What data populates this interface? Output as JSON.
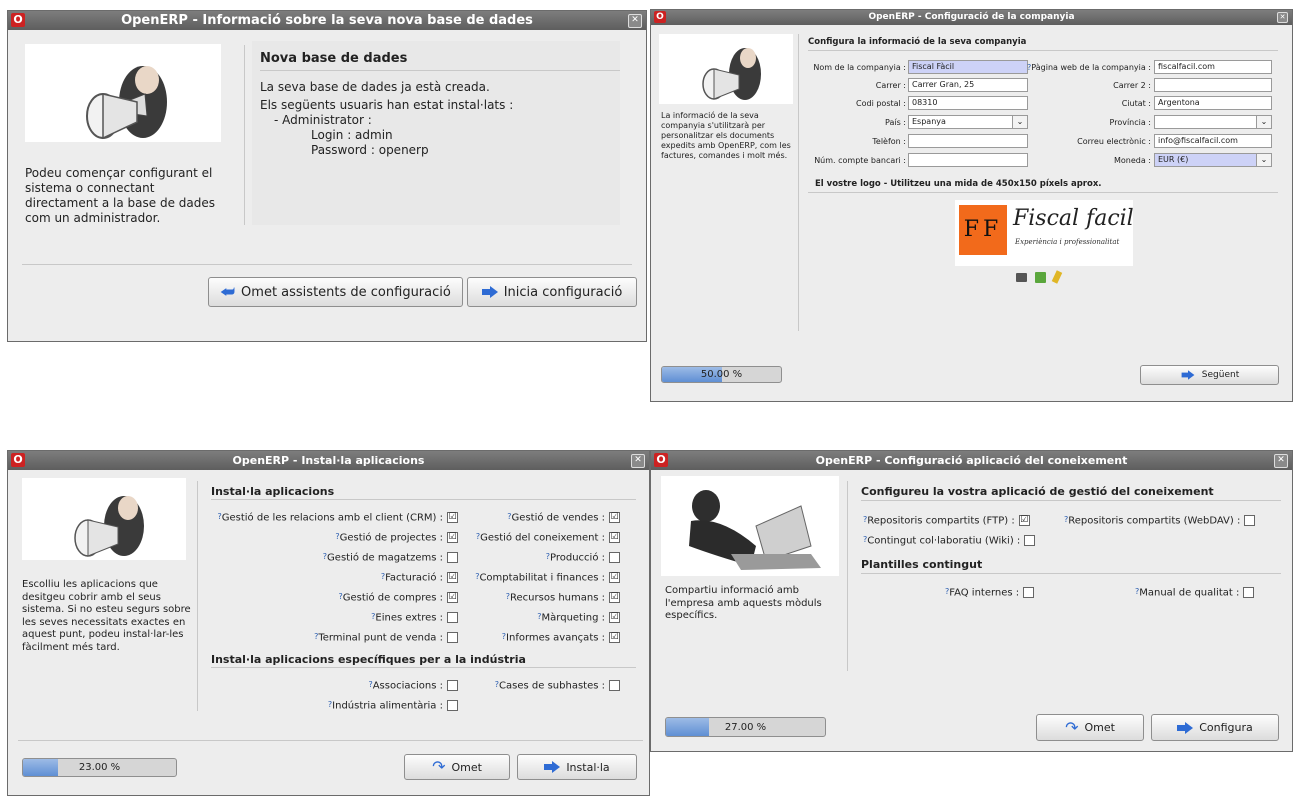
{
  "w1": {
    "title": "OpenERP - Informació sobre la seva nova base de dades",
    "section": "Nova base de dades",
    "line1": "La seva base de dades ja està creada.",
    "line2": "Els següents usuaris han estat instal·lats :",
    "line3": "- Administrator :",
    "line4": "Login : admin",
    "line5": "Password : openerp",
    "desc": "Podeu començar configurant el sistema o connectant directament a la base de dades com un administrador.",
    "skip_button": "Omet assistents de configuració",
    "start_button": "Inicia configuració"
  },
  "w2": {
    "title": "OpenERP - Configuració de la companyia",
    "section": "Configura la informació de la seva companyia",
    "desc": "La informació de la seva companyia s'utilitzarà per personalitzar els documents expedits amb OpenERP, com les factures, comandes i molt més.",
    "labels": {
      "name": "Nom de la companyia :",
      "street": "Carrer :",
      "zip": "Codi postal :",
      "country": "País :",
      "phone": "Telèfon :",
      "bank": "Núm. compte bancari :",
      "web": "Pàgina web de la companyia :",
      "street2": "Carrer 2 :",
      "city": "Ciutat :",
      "province": "Província :",
      "email": "Correu electrònic :",
      "currency": "Moneda :"
    },
    "values": {
      "name": "Fiscal Fàcil",
      "street": "Carrer Gran, 25",
      "zip": "08310",
      "country": "Espanya",
      "phone": "",
      "bank": "",
      "web": "fiscalfacil.com",
      "street2": "",
      "city": "Argentona",
      "province": "",
      "email": "info@fiscalfacil.com",
      "currency": "EUR (€)"
    },
    "logo_section": "El vostre logo - Utilitzeu una mida de 450x150 píxels aprox.",
    "logo_mark": "FF",
    "logo_name": "Fiscal facil",
    "logo_tagline": "Experiència i professionalitat",
    "progress_text": "50.00 %",
    "progress_value": 0.5,
    "next_button": "Següent"
  },
  "w3": {
    "title": "OpenERP - Instal·la aplicacions",
    "section1": "Instal·la aplicacions",
    "section2": "Instal·la aplicacions específiques per a la indústria",
    "desc": "Escolliu les aplicacions que desitgeu cobrir amb el seus sistema. Si no esteu segurs sobre les seves necessitats exactes en aquest punt, podeu instal·lar-les fàcilment més tard.",
    "apps_left": [
      {
        "label": "Gestió de les relacions amb el client (CRM) :",
        "checked": "☑"
      },
      {
        "label": "Gestió de projectes :",
        "checked": "☑"
      },
      {
        "label": "Gestió de magatzems :",
        "checked": ""
      },
      {
        "label": "Facturació :",
        "checked": "☑"
      },
      {
        "label": "Gestió de compres :",
        "checked": "☑"
      },
      {
        "label": "Eines extres :",
        "checked": ""
      },
      {
        "label": "Terminal punt de venda :",
        "checked": ""
      }
    ],
    "apps_right": [
      {
        "label": "Gestió de vendes :",
        "checked": "☑"
      },
      {
        "label": "Gestió del coneixement :",
        "checked": "☑"
      },
      {
        "label": "Producció :",
        "checked": ""
      },
      {
        "label": "Comptabilitat i finances :",
        "checked": "☑"
      },
      {
        "label": "Recursos humans :",
        "checked": "☑"
      },
      {
        "label": "Màrqueting :",
        "checked": "☑"
      },
      {
        "label": "Informes avançats :",
        "checked": "☑"
      }
    ],
    "ind_left": [
      {
        "label": "Associacions :",
        "checked": ""
      },
      {
        "label": "Indústria alimentària :",
        "checked": ""
      }
    ],
    "ind_right": [
      {
        "label": "Cases de subhastes :",
        "checked": ""
      }
    ],
    "progress_text": "23.00 %",
    "progress_value": 0.23,
    "skip_button": "Omet",
    "install_button": "Instal·la"
  },
  "w4": {
    "title": "OpenERP - Configuració aplicació del coneixement",
    "section1": "Configureu la vostra aplicació de gestió del coneixement",
    "section2": "Plantilles contingut",
    "desc": "Compartiu informació amb l'empresa amb aquests mòduls específics.",
    "opt1": "Repositoris compartits (FTP) :",
    "opt1_checked": "☑",
    "opt2": "Repositoris compartits (WebDAV) :",
    "opt2_checked": "",
    "opt3": "Contingut col·laboratiu (Wiki) :",
    "opt3_checked": "",
    "opt4": "FAQ internes :",
    "opt4_checked": "",
    "opt5": "Manual de qualitat :",
    "opt5_checked": "",
    "progress_text": "27.00 %",
    "progress_value": 0.27,
    "skip_button": "Omet",
    "configure_button": "Configura"
  },
  "help_marker": "?",
  "app_logo": "O",
  "close_glyph": "✕",
  "colors": {
    "titlebar": "#6e6e6e",
    "window_bg": "#ededed",
    "required_field": "#cdd2f7",
    "progress_fill": "#7fa5de",
    "logo_orange": "#f26a1b",
    "arrow_blue": "#2e6bd4"
  }
}
